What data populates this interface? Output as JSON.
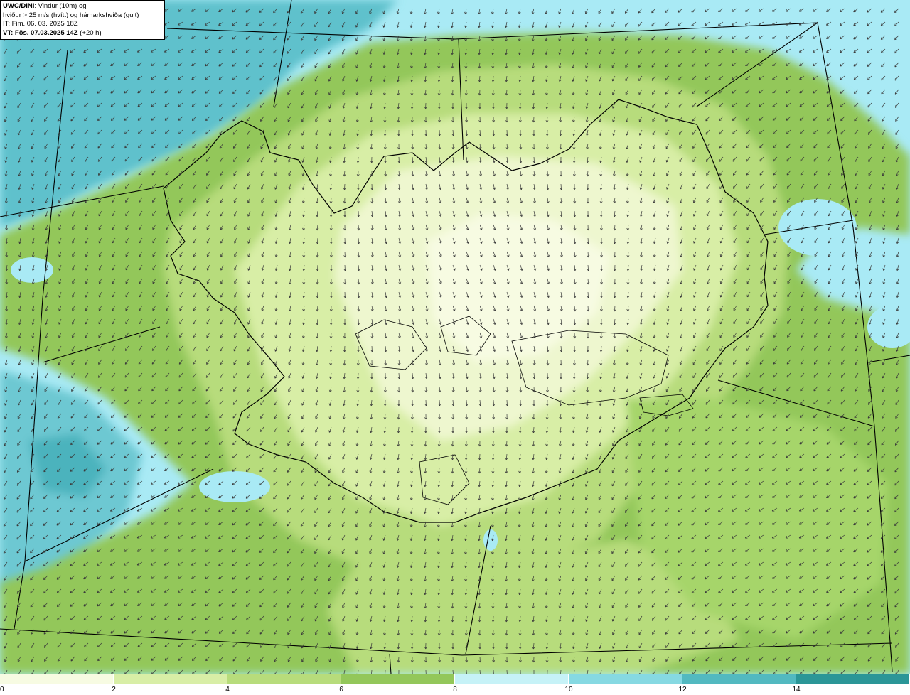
{
  "header": {
    "model": "UWC/DINI",
    "title_rest": ": Vindur (10m) og",
    "line2": "hviður > 25 m/s (hvítt) og hámarkshviða (gult)",
    "it_line": "IT: Fim. 06. 03. 2025 18Z",
    "vt_bold": "VT: Fös. 07.03.2025 14Z",
    "vt_lead": " (+20 h)"
  },
  "legend": {
    "colors": [
      "#f7fbe2",
      "#d8eea6",
      "#b7dc7b",
      "#93c75a",
      "#c6f2f7",
      "#86d9e2",
      "#52b9c0",
      "#2b9697"
    ],
    "ticks": [
      "0",
      "2",
      "4",
      "6",
      "8",
      "10",
      "12",
      "14"
    ]
  },
  "map": {
    "ocean_color": "#a9eaf5",
    "land_outline_color": "#000000"
  }
}
